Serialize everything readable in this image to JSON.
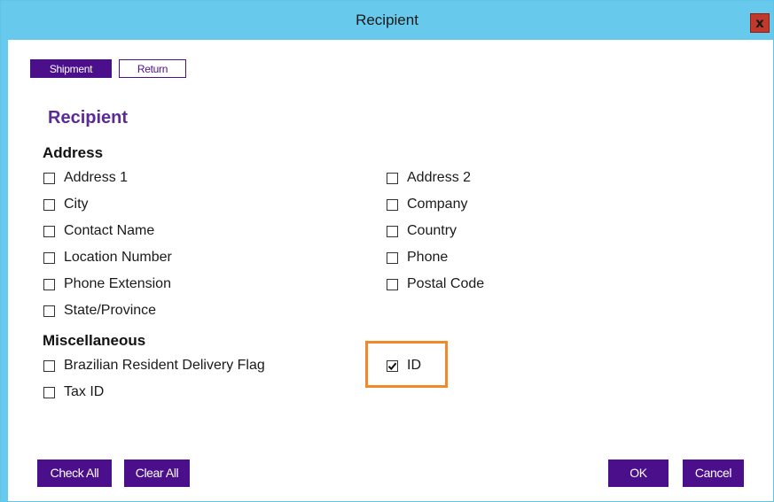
{
  "window": {
    "title": "Recipient",
    "close_label": "x"
  },
  "tabs": {
    "shipment": "Shipment",
    "return": "Return"
  },
  "section_title": "Recipient",
  "address": {
    "heading": "Address",
    "left": [
      "Address 1",
      "City",
      "Contact Name",
      "Location Number",
      "Phone Extension",
      "State/Province"
    ],
    "right": [
      "Address 2",
      "Company",
      "Country",
      "Phone",
      "Postal Code"
    ]
  },
  "misc": {
    "heading": "Miscellaneous",
    "left": [
      "Brazilian Resident Delivery Flag",
      "Tax ID"
    ],
    "right": [
      "ID"
    ],
    "right_checked": [
      true
    ]
  },
  "buttons": {
    "check_all": "Check All",
    "clear_all": "Clear All",
    "ok": "OK",
    "cancel": "Cancel"
  },
  "colors": {
    "titlebar": "#67c9ec",
    "accent": "#4b0f8c",
    "section": "#5b2a97",
    "highlight": "#f0892c"
  }
}
